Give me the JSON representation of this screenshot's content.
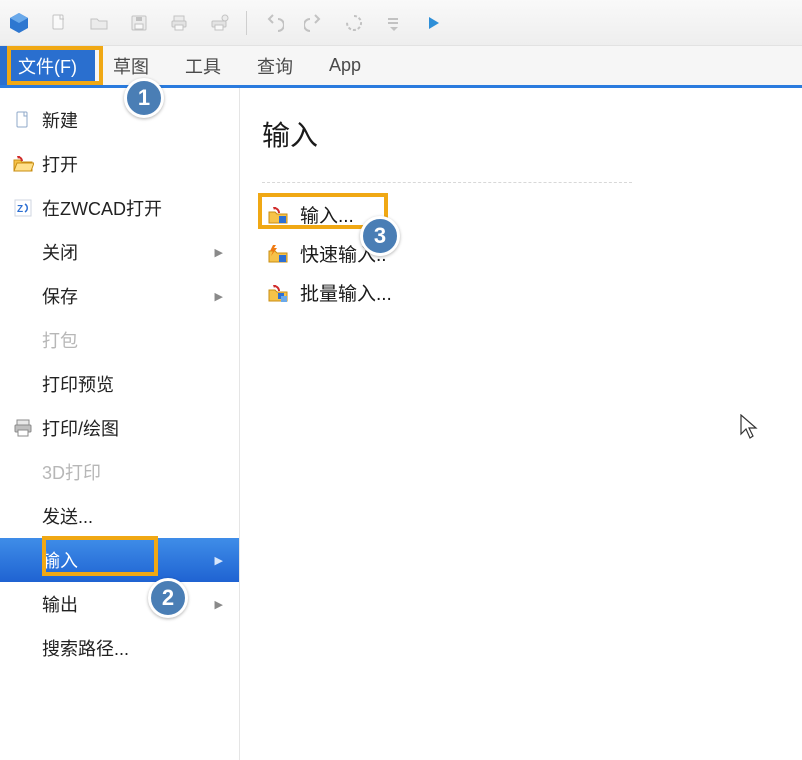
{
  "menubar": {
    "items": [
      {
        "label": "文件(F)",
        "active": true
      },
      {
        "label": "草图"
      },
      {
        "label": "工具"
      },
      {
        "label": "查询"
      },
      {
        "label": "App"
      }
    ]
  },
  "sidebar": {
    "items": [
      {
        "label": "新建",
        "icon": "new-file-icon"
      },
      {
        "label": "打开",
        "icon": "open-folder-icon"
      },
      {
        "label": "在ZWCAD打开",
        "icon": "zwcad-icon"
      },
      {
        "label": "关闭",
        "submenu": true
      },
      {
        "label": "保存",
        "submenu": true
      },
      {
        "label": "打包",
        "disabled": true
      },
      {
        "label": "打印预览"
      },
      {
        "label": "打印/绘图",
        "icon": "printer-icon"
      },
      {
        "label": "3D打印",
        "disabled": true
      },
      {
        "label": "发送..."
      },
      {
        "label": "输入",
        "submenu": true,
        "hovered": true
      },
      {
        "label": "输出",
        "submenu": true
      },
      {
        "label": "搜索路径..."
      }
    ]
  },
  "panel": {
    "title": "输入",
    "commands": [
      {
        "label": "输入...",
        "icon": "import-icon",
        "highlight": true
      },
      {
        "label": "快速输入..",
        "icon": "quick-import-icon"
      },
      {
        "label": "批量输入...",
        "icon": "batch-import-icon"
      }
    ]
  },
  "annotations": {
    "badges": [
      {
        "num": "1"
      },
      {
        "num": "2"
      },
      {
        "num": "3"
      }
    ]
  },
  "colors": {
    "highlight_border": "#f0a814",
    "active_menu_bg": "#2a6fcf",
    "badge_bg": "#4a7eb5",
    "accent_line": "#2a7bde"
  }
}
